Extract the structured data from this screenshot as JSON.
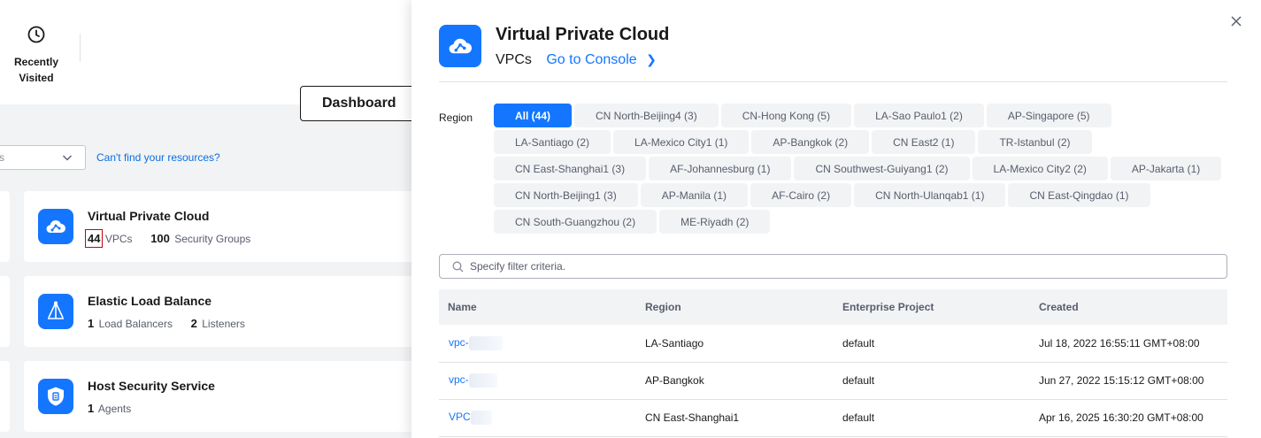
{
  "left": {
    "recently_visited_label": "Recently Visited",
    "dashboard_label": "Dashboard",
    "select_value": "s",
    "cant_find_label": "Can't find your resources?",
    "cards": [
      {
        "title": "Virtual Private Cloud",
        "icon": "cloud-vpc-icon",
        "stat1_value": "44",
        "stat1_label": "VPCs",
        "stat2_value": "100",
        "stat2_label": "Security Groups"
      },
      {
        "title": "Elastic Load Balance",
        "icon": "load-balancer-icon",
        "stat1_value": "1",
        "stat1_label": "Load Balancers",
        "stat2_value": "2",
        "stat2_label": "Listeners"
      },
      {
        "title": "Host Security Service",
        "icon": "shield-icon",
        "stat1_value": "1",
        "stat1_label": "Agents"
      }
    ]
  },
  "drawer": {
    "title": "Virtual Private Cloud",
    "subtitle": "VPCs",
    "console_link": "Go to Console",
    "region_label": "Region",
    "regions": [
      "All (44)",
      "CN North-Beijing4 (3)",
      "CN-Hong Kong (5)",
      "LA-Sao Paulo1 (2)",
      "AP-Singapore (5)",
      "LA-Santiago (2)",
      "LA-Mexico City1 (1)",
      "AP-Bangkok (2)",
      "CN East2 (1)",
      "TR-Istanbul (2)",
      "CN East-Shanghai1 (3)",
      "AF-Johannesburg (1)",
      "CN Southwest-Guiyang1 (2)",
      "LA-Mexico City2 (2)",
      "AP-Jakarta (1)",
      "CN North-Beijing1 (3)",
      "AP-Manila (1)",
      "AF-Cairo (2)",
      "CN North-Ulanqab1 (1)",
      "CN East-Qingdao (1)",
      "CN South-Guangzhou (2)",
      "ME-Riyadh (2)"
    ],
    "active_region": "All (44)",
    "filter_placeholder": "Specify filter criteria.",
    "table": {
      "headers": [
        "Name",
        "Region",
        "Enterprise Project",
        "Created"
      ],
      "rows": [
        {
          "name": "vpc-",
          "region": "LA-Santiago",
          "project": "default",
          "created": "Jul 18, 2022 16:55:11 GMT+08:00"
        },
        {
          "name": "vpc-",
          "region": "AP-Bangkok",
          "project": "default",
          "created": "Jun 27, 2022 15:15:12 GMT+08:00"
        },
        {
          "name": "VPC",
          "region": "CN East-Shanghai1",
          "project": "default",
          "created": "Apr 16, 2025 16:30:20 GMT+08:00"
        }
      ]
    }
  },
  "colors": {
    "accent": "#1476ff",
    "highlight": "#c7000b",
    "panel_bg": "#f2f3f5"
  }
}
